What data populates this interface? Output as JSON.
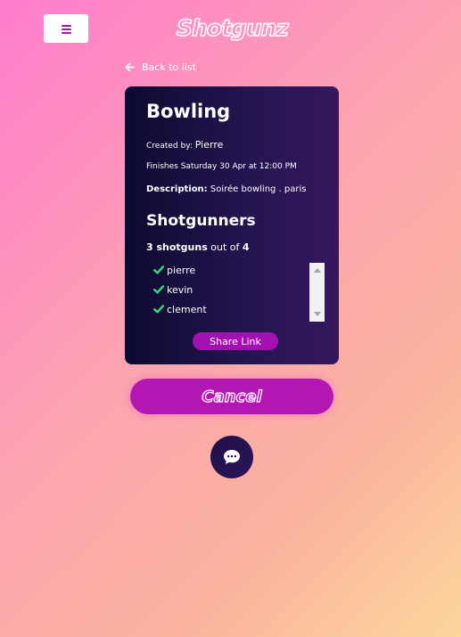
{
  "header": {
    "logo_text": "Shotgunz",
    "menu_icon": "hamburger-icon"
  },
  "nav": {
    "back_label": "Back to list",
    "back_icon": "arrow-left-icon"
  },
  "event": {
    "title": "Bowling",
    "created_by_label": "Created by:",
    "created_by_name": "Pierre",
    "finishes_text": "Finishes Saturday 30 Apr at 12:00 PM",
    "description_label": "Description:",
    "description_value": "Soirée bowling . paris"
  },
  "shotgunners": {
    "title": "Shotgunners",
    "count_text": "3 shotguns",
    "out_of_text": "out of",
    "max_count": "4",
    "check_icon": "check-icon",
    "check_color": "#2ee07a",
    "items": [
      {
        "name": "pierre"
      },
      {
        "name": "kevin"
      },
      {
        "name": "clement"
      }
    ]
  },
  "actions": {
    "share_label": "Share Link",
    "cancel_label": "Cancel",
    "chat_icon": "chat-bubble-icon"
  },
  "colors": {
    "accent": "#b416b4",
    "card_start": "#0d0a30",
    "card_end": "#35175e"
  }
}
